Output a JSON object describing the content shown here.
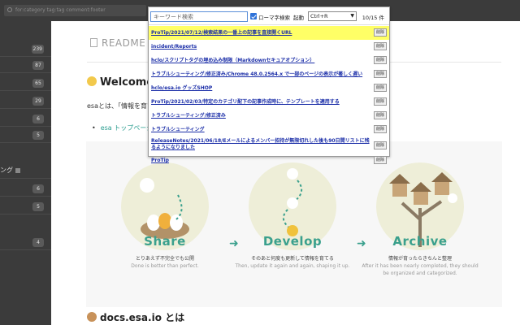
{
  "topbar": {
    "search_placeholder": "for:category tag:tag comment:footer"
  },
  "sidebar": {
    "badges": [
      "239",
      "87",
      "65",
      "29",
      "6",
      "5",
      "",
      "6",
      "5",
      "4"
    ],
    "partial_label": "ング"
  },
  "main": {
    "readme": "README",
    "welcome": "Welcome to",
    "intro_prefix": "esaとは、「情報を育て",
    "bullet": "esa トップページ",
    "stages": [
      {
        "title": "Share",
        "jp": "とりあえず不完全でも公開",
        "en": "Done is better than perfect."
      },
      {
        "title": "Develop",
        "jp": "そのあと何度も更新して情報を育てる",
        "en": "Then, update it again and again, shaping it up."
      },
      {
        "title": "Archive",
        "jp": "情報が育ったらきちんと整理",
        "en": "After it has been nearly completed, they should be organized and categorized."
      }
    ],
    "docs_title": "docs.esa.io とは"
  },
  "popup": {
    "keyword_placeholder": "キーワード検索",
    "romaji_label": "ローマ字検索",
    "launch_label": "起動",
    "shortcut_value": "Ctrl+R",
    "count": "10/15 件",
    "delete_label": "削除",
    "items": [
      "ProTip/2021/07/12/検索結果の一番上の記事を直接開くURL",
      "incident/Reports",
      "hclo/スクリプトタグの埋め込み制限（Markdownセキュアオプション）",
      "トラブルシューティング/修正済み/Chrome 48.0.2564.x で一部のページの表示が著しく遅い",
      "hclo/esa.io グッズSHOP",
      "ProTip/2021/02/03/特定のカテゴリ配下の記事作成時に、テンプレートを適用する",
      "トラブルシューティング/修正済み",
      "トラブルシューティング",
      "ReleaseNotes/2021/06/18/Eメールによるメンバー招待が無限切れした後も90日間リストに残るようになりました",
      "ProTip"
    ]
  },
  "colors": {
    "accent": "#3aa08d",
    "highlight": "#ffff66",
    "link": "#1b2ea8",
    "sidebar": "#3b3b3b"
  }
}
